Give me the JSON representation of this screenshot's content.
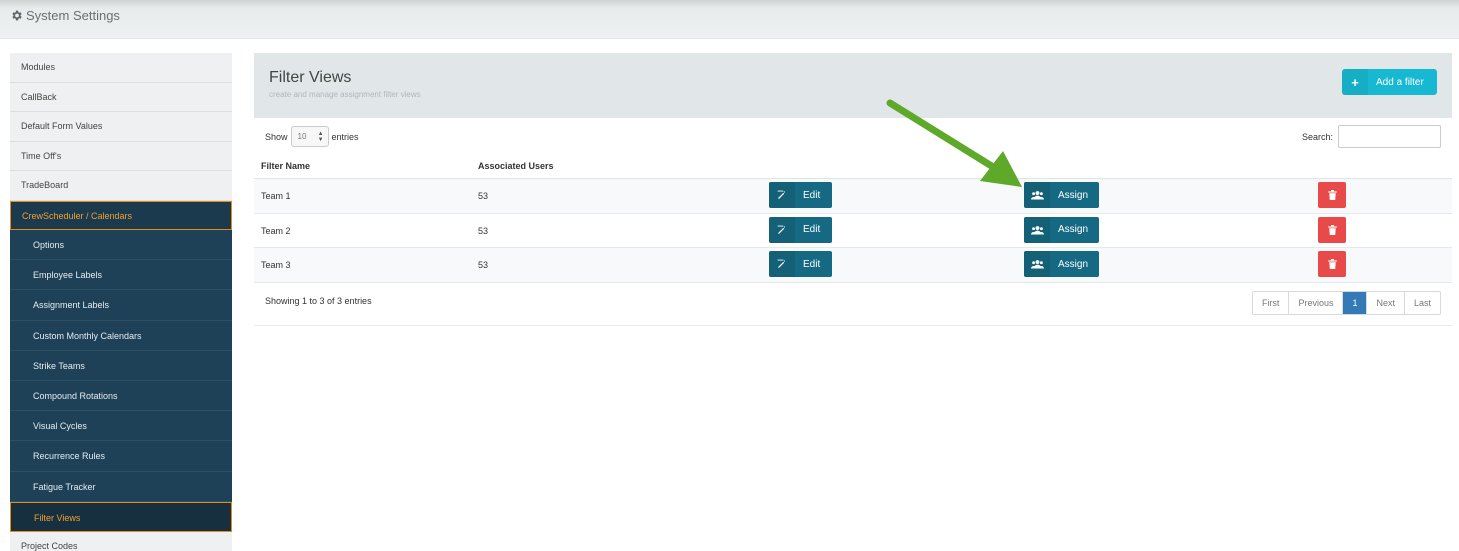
{
  "topbar": {
    "title": "System Settings"
  },
  "sidebar": {
    "items_top": [
      "Modules",
      "CallBack",
      "Default Form Values",
      "Time Off's",
      "TradeBoard"
    ],
    "active_parent": "CrewScheduler / Calendars",
    "sub_items": [
      "Options",
      "Employee Labels",
      "Assignment Labels",
      "Custom Monthly Calendars",
      "Strike Teams",
      "Compound Rotations",
      "Visual Cycles",
      "Recurrence Rules",
      "Fatigue Tracker"
    ],
    "current_sub": "Filter Views",
    "items_bottom": [
      "Project Codes"
    ]
  },
  "panel": {
    "title": "Filter Views",
    "subtitle": "create and manage assignment filter views",
    "add_label": "Add a filter"
  },
  "controls": {
    "show_label": "Show",
    "entries_value": "10",
    "entries_label": "entries",
    "search_label": "Search:"
  },
  "table": {
    "headers": [
      "Filter Name",
      "Associated Users"
    ],
    "rows": [
      {
        "name": "Team 1",
        "users": "53"
      },
      {
        "name": "Team 2",
        "users": "53"
      },
      {
        "name": "Team 3",
        "users": "53"
      }
    ],
    "edit_label": "Edit",
    "assign_label": "Assign"
  },
  "footer": {
    "info": "Showing 1 to 3 of 3 entries",
    "pages": [
      "First",
      "Previous",
      "1",
      "Next",
      "Last"
    ]
  },
  "colors": {
    "accent": "#17b9d2",
    "button": "#166982",
    "danger": "#e84a4a",
    "sidebar": "#1e4158",
    "highlight": "#f0a030",
    "annotation": "#5ea82a"
  }
}
